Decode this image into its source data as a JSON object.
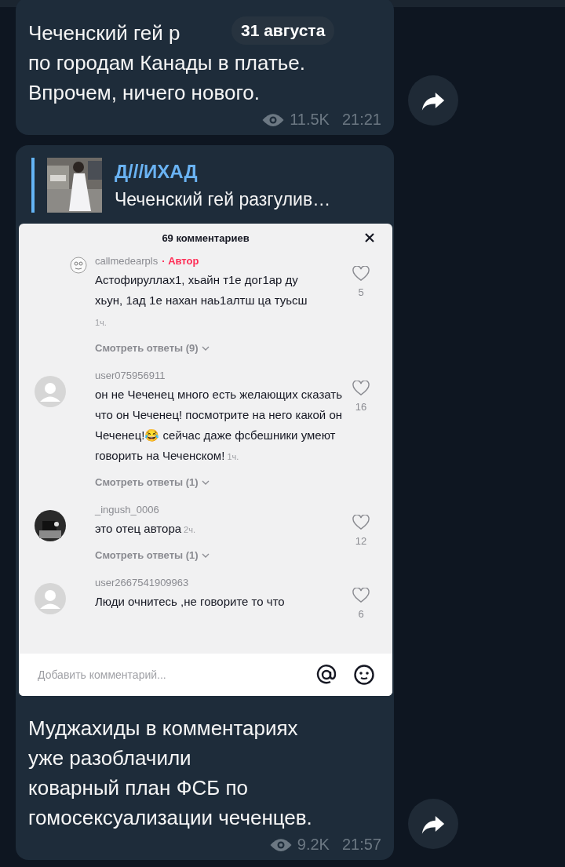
{
  "date_badge": "31 августа",
  "messages": [
    {
      "text_lines": [
        "Чеченский гей р",
        "по городам Канады в платье.",
        "Впрочем, ничего нового."
      ],
      "views": "11.5K",
      "time": "21:21"
    },
    {
      "reply": {
        "author": "Д///ИХАД",
        "text": "Чеченский гей разгулив…"
      },
      "screenshot": {
        "title": "69 комментариев",
        "placeholder": "Добавить комментарий...",
        "comments": [
          {
            "kind": "sketch",
            "user": "callmedearpls",
            "badge": "· Автор",
            "text": "Астофируллах1, хьайн т1е дог1ар ду хьун, 1ад 1е нахан наь1алтш ца туьсш",
            "age": "1ч.",
            "likes": "5",
            "replies": "Смотреть ответы (9)"
          },
          {
            "kind": "default",
            "user": "user075956911",
            "text": "он не Чеченец много есть желающих сказать что он Чеченец! посмотрите на него какой он Чеченец!😂 сейчас даже фсбешники умеют говорить на Чеченском!",
            "age": "1ч.",
            "likes": "16",
            "replies": "Смотреть ответы (1)"
          },
          {
            "user": "_ingush_0006",
            "text": "это отец автора",
            "age": "2ч.",
            "likes": "12",
            "replies": "Смотреть ответы (1)"
          },
          {
            "kind": "default",
            "user": "user2667541909963",
            "text": "Люди очнитесь ,не говорите то что",
            "likes": "6"
          }
        ]
      },
      "text_lines": [
        "Муджахиды в комментариях",
        "уже разоблачили",
        "коварный план ФСБ по",
        "гомосексуализации чеченцев."
      ],
      "views": "9.2K",
      "time": "21:57"
    }
  ]
}
